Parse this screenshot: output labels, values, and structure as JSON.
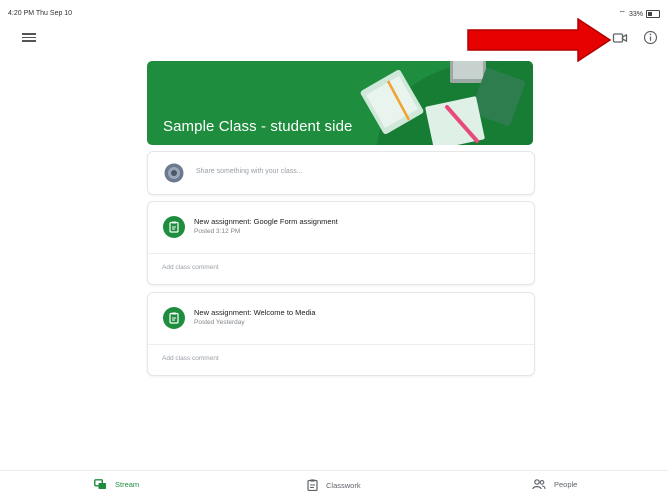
{
  "status_bar": {
    "time": "4:20 PM  Thu Sep 10",
    "battery": "33%"
  },
  "top_bar": {
    "menu_icon": "hamburger-menu-icon",
    "meet_icon": "video-camera-icon",
    "info_icon": "info-circle-icon"
  },
  "annotation": {
    "arrow_color": "#e60000"
  },
  "banner": {
    "title": "Sample Class - student side",
    "color": "#1e8e3e"
  },
  "share": {
    "placeholder": "Share something with your class..."
  },
  "posts": [
    {
      "title": "New assignment: Google Form assignment",
      "subtitle": "Posted 3:12 PM",
      "comment_placeholder": "Add class comment"
    },
    {
      "title": "New assignment: Welcome to Media",
      "subtitle": "Posted Yesterday",
      "comment_placeholder": "Add class comment"
    }
  ],
  "bottom_nav": {
    "stream": "Stream",
    "classwork": "Classwork",
    "people": "People",
    "active": "stream"
  }
}
